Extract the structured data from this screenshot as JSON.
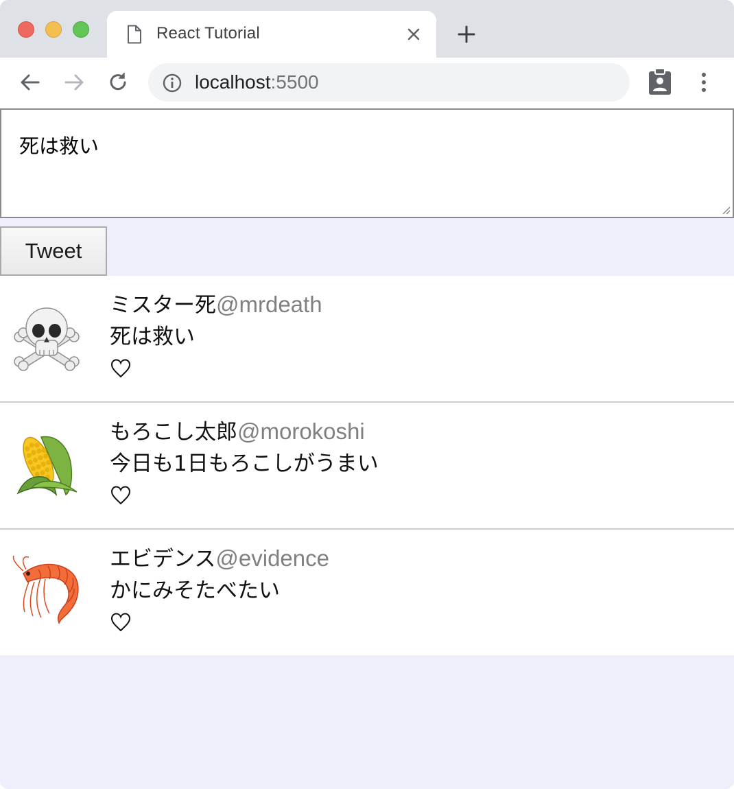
{
  "browser": {
    "tab": {
      "title": "React Tutorial",
      "icon": "document-icon"
    },
    "address_bar": {
      "host": "localhost",
      "port": ":5500"
    },
    "colors": {
      "tabstrip": "#dee1e6",
      "close": "#ed6a5e",
      "minimize": "#f5bf4f",
      "maximize": "#62c655"
    }
  },
  "composer": {
    "text": "死は救い",
    "button_label": "Tweet"
  },
  "tweets": [
    {
      "avatar": "skull-and-crossbones",
      "name": "ミスター死",
      "handle": "@mrdeath",
      "text": "死は救い",
      "like_icon": "heart-outline"
    },
    {
      "avatar": "ear-of-corn",
      "name": "もろこし太郎",
      "handle": "@morokoshi",
      "text": "今日も1日もろこしがうまい",
      "like_icon": "heart-outline"
    },
    {
      "avatar": "shrimp",
      "name": "エビデンス",
      "handle": "@evidence",
      "text": "かにみそたべたい",
      "like_icon": "heart-outline"
    }
  ],
  "page_colors": {
    "background": "#efeffb",
    "handle": "#808080"
  }
}
